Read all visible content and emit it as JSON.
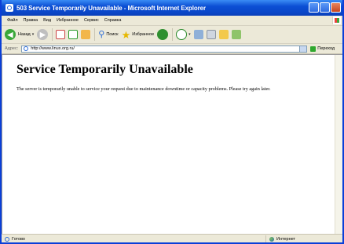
{
  "window": {
    "title": "503 Service Temporarily Unavailable - Microsoft Internet Explorer"
  },
  "menubar": {
    "items": [
      "Файл",
      "Правка",
      "Вид",
      "Избранное",
      "Сервис",
      "Справка"
    ]
  },
  "toolbar": {
    "back_label": "Назад",
    "search_label": "Поиск",
    "favorites_label": "Избранное"
  },
  "addressbar": {
    "label": "Адрес:",
    "url": "http://www.linux.org.ru/",
    "go_label": "Переход"
  },
  "page": {
    "heading": "Service Temporarily Unavailable",
    "message": "The server is temporarily unable to service your request due to maintenance downtime or capacity problems. Please try again later."
  },
  "statusbar": {
    "status_text": "Готово",
    "zone_text": "Интернет"
  },
  "colors": {
    "titlebar": "#0b4fd4",
    "chrome": "#ece9d8",
    "content_bg": "#ffffff"
  }
}
